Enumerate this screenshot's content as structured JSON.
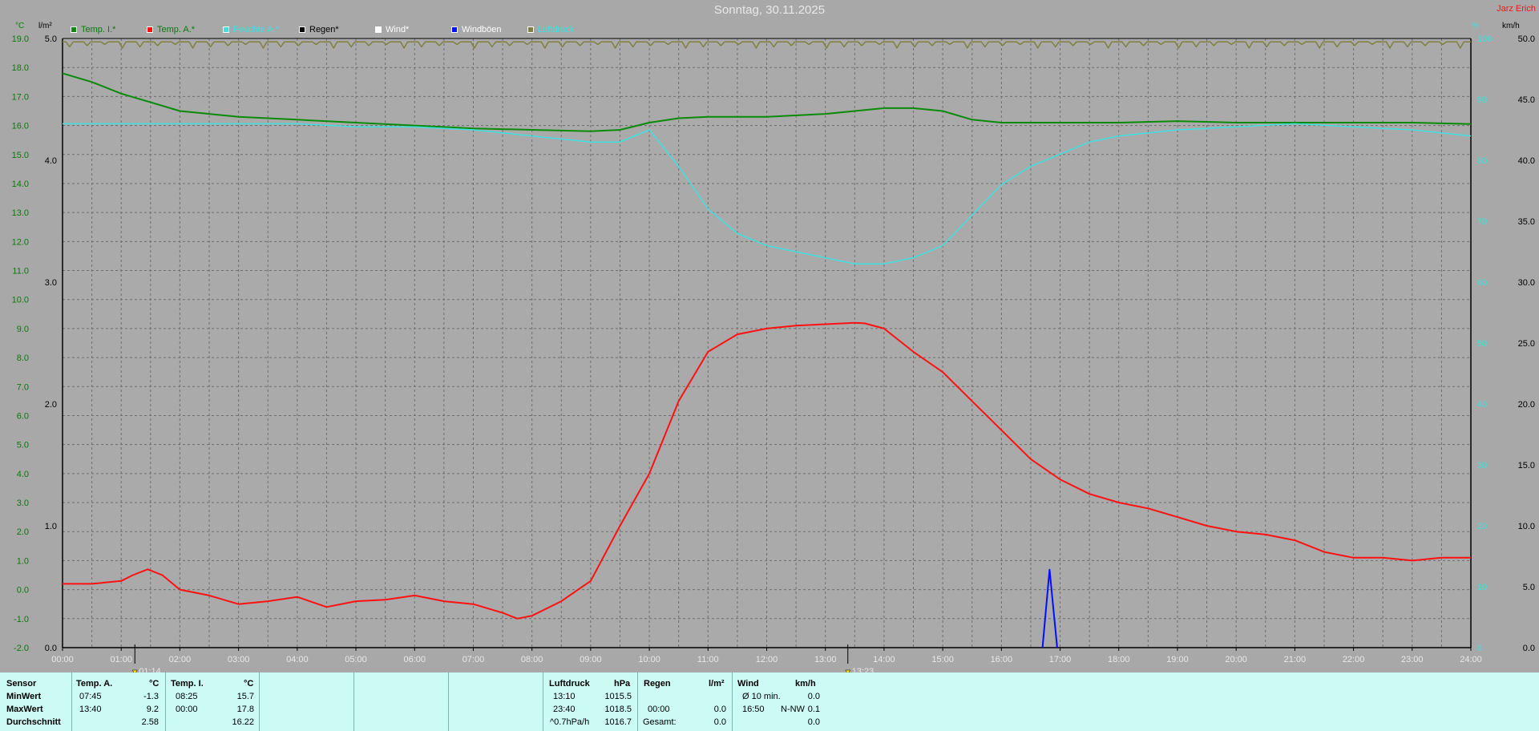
{
  "title": "Sonntag, 30.11.2025",
  "author": "Jarz Erich",
  "units": {
    "left1": "°C",
    "left2": "l/m²",
    "right1": "%",
    "right2": "km/h"
  },
  "legend": [
    {
      "label": "Temp. I.*",
      "color": "#0a8a0a",
      "text_color": "#0a7a0a"
    },
    {
      "label": "Temp. A.*",
      "color": "#ff1010",
      "text_color": "#0a7a0a"
    },
    {
      "label": "Feuchte A.*",
      "color": "#40e0e0",
      "text_color": "#40e0e0"
    },
    {
      "label": "Regen*",
      "color": "#000000",
      "text_color": "#000000"
    },
    {
      "label": "Wind*",
      "color": "#ffffff",
      "text_color": "#ffffff"
    },
    {
      "label": "Windböen",
      "color": "#0010ff",
      "text_color": "#ffffff"
    },
    {
      "label": "Luftdruck",
      "color": "#808040",
      "text_color": "#40e0e0"
    }
  ],
  "markers": [
    "01:14",
    "13:23"
  ],
  "chart_data": {
    "type": "line",
    "x_ticks": [
      "00:00",
      "01:00",
      "02:00",
      "03:00",
      "04:00",
      "05:00",
      "06:00",
      "07:00",
      "08:00",
      "09:00",
      "10:00",
      "11:00",
      "12:00",
      "13:00",
      "14:00",
      "15:00",
      "16:00",
      "17:00",
      "18:00",
      "19:00",
      "20:00",
      "21:00",
      "22:00",
      "23:00",
      "24:00"
    ],
    "axes": {
      "temp": {
        "label": "°C",
        "range": [
          -2,
          19
        ],
        "ticks": [
          "19.0",
          "18.0",
          "17.0",
          "16.0",
          "15.0",
          "14.0",
          "13.0",
          "12.0",
          "11.0",
          "10.0",
          "9.0",
          "8.0",
          "7.0",
          "6.0",
          "5.0",
          "4.0",
          "3.0",
          "2.0",
          "1.0",
          "0.0",
          "-1.0",
          "-2.0"
        ]
      },
      "rain": {
        "label": "l/m²",
        "range": [
          0,
          5
        ],
        "ticks": [
          "5.0",
          "4.0",
          "3.0",
          "2.0",
          "1.0",
          "0.0"
        ]
      },
      "humidity": {
        "label": "%",
        "range": [
          0,
          100
        ],
        "ticks": [
          "100",
          "90",
          "80",
          "70",
          "60",
          "50",
          "40",
          "30",
          "20",
          "10",
          "0"
        ]
      },
      "wind": {
        "label": "km/h",
        "range": [
          0,
          50
        ],
        "ticks": [
          "50.0",
          "45.0",
          "40.0",
          "35.0",
          "30.0",
          "25.0",
          "20.0",
          "15.0",
          "10.0",
          "5.0",
          "0.0"
        ]
      }
    },
    "series": [
      {
        "name": "Temp. I.*",
        "axis": "temp",
        "color": "#0a8a0a",
        "x": [
          0,
          0.5,
          1,
          1.5,
          2,
          2.5,
          3,
          4,
          5,
          6,
          7,
          8,
          9,
          9.5,
          10,
          10.5,
          11,
          12,
          13,
          13.5,
          14,
          14.5,
          15,
          15.5,
          16,
          17,
          18,
          19,
          20,
          21,
          22,
          23,
          24
        ],
        "y": [
          17.8,
          17.5,
          17.1,
          16.8,
          16.5,
          16.4,
          16.3,
          16.2,
          16.1,
          16.0,
          15.9,
          15.85,
          15.8,
          15.85,
          16.1,
          16.25,
          16.3,
          16.3,
          16.4,
          16.5,
          16.6,
          16.6,
          16.5,
          16.2,
          16.1,
          16.1,
          16.1,
          16.15,
          16.1,
          16.1,
          16.1,
          16.1,
          16.05
        ]
      },
      {
        "name": "Temp. A.*",
        "axis": "temp",
        "color": "#ff1010",
        "x": [
          0,
          0.5,
          1,
          1.2,
          1.45,
          1.7,
          2,
          2.5,
          3,
          3.5,
          4,
          4.5,
          5,
          5.5,
          6,
          6.5,
          7,
          7.5,
          7.75,
          8,
          8.5,
          9,
          9.5,
          10,
          10.5,
          11,
          11.5,
          12,
          12.5,
          13,
          13.5,
          13.67,
          14,
          14.5,
          15,
          15.5,
          16,
          16.5,
          17,
          17.5,
          18,
          18.5,
          19,
          19.5,
          20,
          20.5,
          21,
          21.5,
          22,
          22.5,
          23,
          23.5,
          24
        ],
        "y": [
          0.2,
          0.2,
          0.3,
          0.5,
          0.7,
          0.5,
          0.0,
          -0.2,
          -0.5,
          -0.4,
          -0.25,
          -0.6,
          -0.4,
          -0.35,
          -0.2,
          -0.4,
          -0.5,
          -0.8,
          -1.0,
          -0.9,
          -0.4,
          0.3,
          2.2,
          4.0,
          6.5,
          8.2,
          8.8,
          9.0,
          9.1,
          9.15,
          9.2,
          9.18,
          9.0,
          8.2,
          7.5,
          6.5,
          5.5,
          4.5,
          3.8,
          3.3,
          3.0,
          2.8,
          2.5,
          2.2,
          2.0,
          1.9,
          1.7,
          1.3,
          1.1,
          1.1,
          1.0,
          1.1,
          1.1
        ]
      },
      {
        "name": "Feuchte A.*",
        "axis": "humidity",
        "color": "#40e0e0",
        "x": [
          0,
          1,
          2,
          3,
          4,
          5,
          6,
          7,
          8,
          9,
          9.5,
          10,
          10.5,
          11,
          11.5,
          12,
          12.5,
          13,
          13.5,
          14,
          14.5,
          15,
          15.5,
          16,
          16.5,
          17,
          17.5,
          18,
          19,
          20,
          21,
          22,
          23,
          24
        ],
        "y": [
          86,
          86,
          86,
          86,
          86,
          85.5,
          85.5,
          85,
          84,
          83,
          83,
          85,
          79,
          72,
          68,
          66,
          65,
          64,
          63,
          63,
          64,
          66,
          71,
          76,
          79,
          81,
          83,
          84,
          85,
          85.5,
          86,
          85.5,
          85,
          84
        ]
      },
      {
        "name": "Windböen",
        "axis": "wind",
        "color": "#0010ff",
        "x": [
          16.7,
          16.82,
          16.95
        ],
        "y": [
          0,
          6.4,
          0
        ]
      },
      {
        "name": "Luftdruck",
        "axis": "humidity",
        "color": "#808040",
        "x": [
          0,
          24
        ],
        "y": [
          99.5,
          99.5
        ]
      }
    ]
  },
  "stats": {
    "headers": {
      "sensor": "Sensor",
      "temp_a": "Temp. A.",
      "temp_a_unit": "°C",
      "temp_i": "Temp. I.",
      "temp_i_unit": "°C",
      "pressure": "Luftdruck",
      "pressure_unit": "hPa",
      "rain": "Regen",
      "rain_unit": "l/m²",
      "wind": "Wind",
      "wind_unit": "km/h"
    },
    "rows": [
      {
        "label": "MinWert",
        "temp_a_time": "07:45",
        "temp_a_val": "-1.3",
        "temp_i_time": "08:25",
        "temp_i_val": "15.7",
        "pressure_time": "13:10",
        "pressure_val": "1015.5",
        "rain_time": "",
        "rain_val": "",
        "wind_time": "Ø 10 min.",
        "wind_dir": "",
        "wind_val": "0.0"
      },
      {
        "label": "MaxWert",
        "temp_a_time": "13:40",
        "temp_a_val": "9.2",
        "temp_i_time": "00:00",
        "temp_i_val": "17.8",
        "pressure_time": "23:40",
        "pressure_val": "1018.5",
        "rain_time": "00:00",
        "rain_val": "0.0",
        "wind_time": "16:50",
        "wind_dir": "N-NW",
        "wind_val": "0.1"
      },
      {
        "label": "Durchschnitt",
        "temp_a_time": "",
        "temp_a_val": "2.58",
        "temp_i_time": "",
        "temp_i_val": "16.22",
        "pressure_time": "^0.7hPa/h",
        "pressure_val": "1016.7",
        "rain_time": "Gesamt:",
        "rain_val": "0.0",
        "wind_time": "",
        "wind_dir": "",
        "wind_val": "0.0"
      }
    ]
  }
}
